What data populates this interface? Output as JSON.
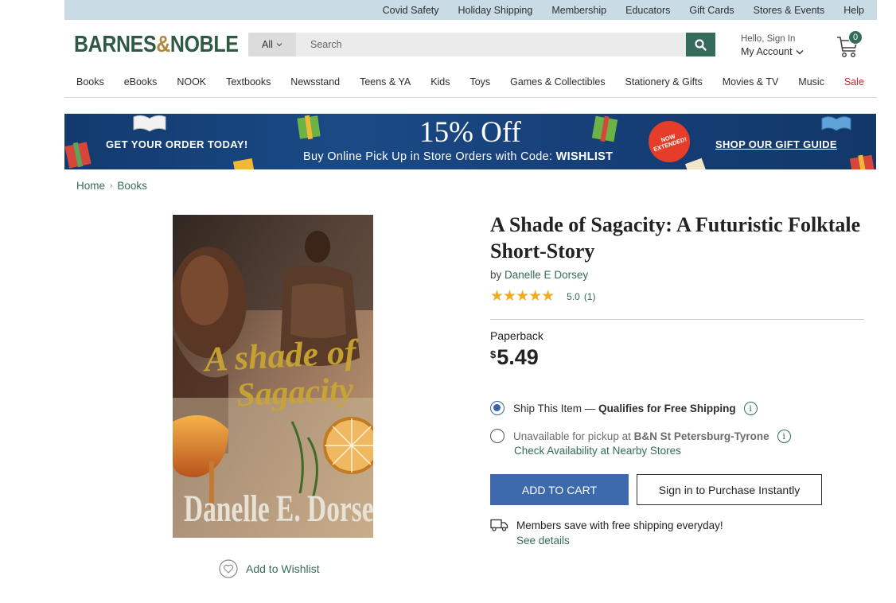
{
  "utility_nav": [
    "Covid Safety",
    "Holiday Shipping",
    "Membership",
    "Educators",
    "Gift Cards",
    "Stores & Events",
    "Help"
  ],
  "logo": {
    "part1": "BARNES",
    "amp": "&",
    "part2": "NOBLE"
  },
  "search": {
    "category": "All",
    "placeholder": "Search"
  },
  "account": {
    "greeting": "Hello, Sign In",
    "label": "My Account"
  },
  "cart": {
    "count": "0"
  },
  "category_nav": [
    "Books",
    "eBooks",
    "NOOK",
    "Textbooks",
    "Newsstand",
    "Teens & YA",
    "Kids",
    "Toys",
    "Games & Collectibles",
    "Stationery & Gifts",
    "Movies & TV",
    "Music"
  ],
  "category_sale": "Sale",
  "promo": {
    "left": "GET YOUR ORDER TODAY!",
    "headline": "15% Off",
    "subtitle_prefix": "Buy Online Pick Up in Store Orders with Code: ",
    "code": "WISHLIST",
    "badge_line1": "NOW",
    "badge_line2": "EXTENDED!",
    "link": "SHOP OUR GIFT GUIDE"
  },
  "breadcrumb": [
    "Home",
    "Books"
  ],
  "cover": {
    "title_line1": "A shade of",
    "title_line2": "Sagacity",
    "author": "Danelle E. Dorsey"
  },
  "wishlist_label": "Add to Wishlist",
  "product": {
    "title": "A Shade of Sagacity: A Futuristic Folktale Short-Story",
    "by": "by",
    "author": "Danelle E Dorsey",
    "rating": 5.0,
    "rating_text": "5.0",
    "rating_count": "(1)",
    "format": "Paperback",
    "currency": "$",
    "price": "5.49"
  },
  "shipping": {
    "ship_label": "Ship This Item —",
    "ship_bold": "Qualifies for Free Shipping",
    "pickup_label": "Unavailable for pickup at",
    "pickup_store": "B&N St Petersburg-Tyrone",
    "check_link": "Check Availability at Nearby Stores"
  },
  "buttons": {
    "add_to_cart": "ADD TO CART",
    "sign_in": "Sign in to Purchase Instantly"
  },
  "members": {
    "text": "Members save with free shipping everyday!",
    "link": "See details"
  },
  "colors": {
    "brand_green": "#346b5a",
    "utility_bar": "#c9dce6",
    "primary_button": "#3d6aad",
    "star": "#f3a922",
    "sale": "#c1272d"
  }
}
